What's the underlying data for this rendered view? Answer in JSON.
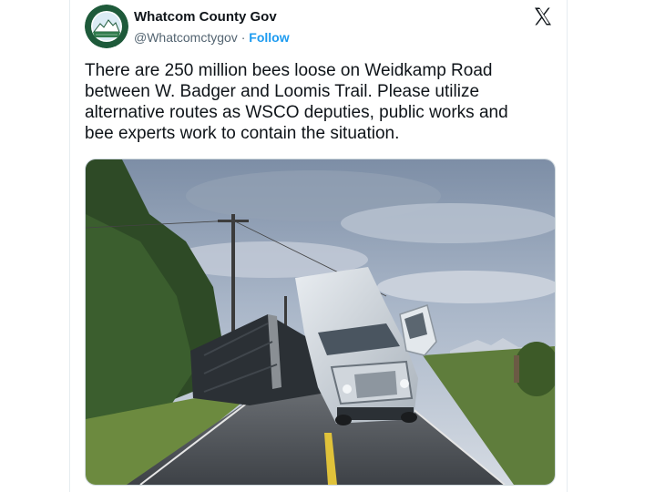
{
  "account": {
    "display_name": "Whatcom County Gov",
    "handle": "@Whatcomctygov",
    "separator": " · ",
    "follow_label": "Follow",
    "avatar_text": "WHATCOM COUNTY"
  },
  "tweet": {
    "text": "There are 250 million bees loose on Weidkamp Road between W. Badger and Loomis Trail. Please utilize alternative routes as WSCO deputies, public works and bee experts work to contain the situation."
  },
  "icons": {
    "platform": "x-logo-icon"
  },
  "colors": {
    "follow": "#1d9bf0",
    "text": "#0f1419",
    "muted": "#536471",
    "avatar_ring": "#1e5a3a"
  }
}
